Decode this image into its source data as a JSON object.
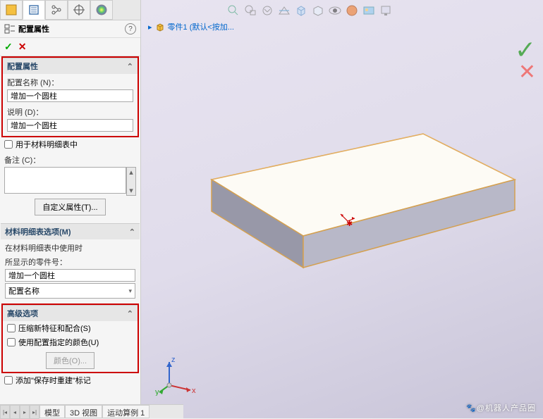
{
  "panel": {
    "title": "配置属性",
    "help": "?"
  },
  "sections": {
    "config_props": {
      "header": "配置属性",
      "name_label": "配置名称 (N)：",
      "name_value": "增加一个圆柱",
      "desc_label": "说明 (D)：",
      "desc_value": "增加一个圆柱"
    },
    "use_in_bom": "用于材料明细表中",
    "remark_label": "备注 (C)：",
    "custom_props_btn": "自定义属性(T)...",
    "bom_options": {
      "header": "材料明细表选项(M)",
      "hint1": "在材料明细表中使用时",
      "hint2": "所显示的零件号：",
      "part_no_value": "增加一个圆柱",
      "source_value": "配置名称"
    },
    "advanced": {
      "header": "高级选项",
      "suppress": "压缩新特征和配合(S)",
      "use_color": "使用配置指定的颜色(U)",
      "color_btn": "颜色(O)...",
      "add_rebuild": "添加\"保存时重建\"标记"
    }
  },
  "bottom_tabs": {
    "t1": "模型",
    "t2": "3D 视图",
    "t3": "运动算例 1"
  },
  "breadcrumb": {
    "arrow": "▸",
    "part": "零件1 (默认<按加..."
  },
  "watermark": "@机器人产品圈"
}
